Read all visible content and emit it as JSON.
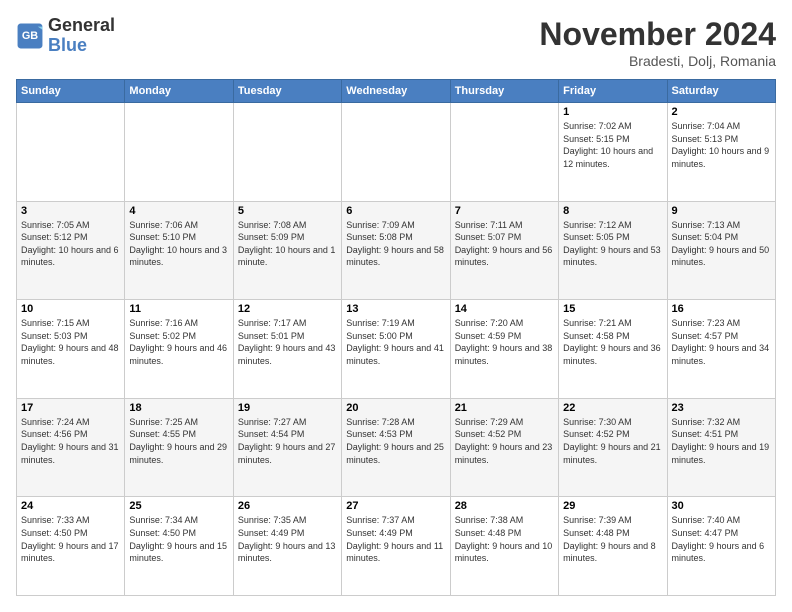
{
  "header": {
    "logo_line1": "General",
    "logo_line2": "Blue",
    "month": "November 2024",
    "location": "Bradesti, Dolj, Romania"
  },
  "weekdays": [
    "Sunday",
    "Monday",
    "Tuesday",
    "Wednesday",
    "Thursday",
    "Friday",
    "Saturday"
  ],
  "weeks": [
    [
      {
        "day": "",
        "info": ""
      },
      {
        "day": "",
        "info": ""
      },
      {
        "day": "",
        "info": ""
      },
      {
        "day": "",
        "info": ""
      },
      {
        "day": "",
        "info": ""
      },
      {
        "day": "1",
        "info": "Sunrise: 7:02 AM\nSunset: 5:15 PM\nDaylight: 10 hours and 12 minutes."
      },
      {
        "day": "2",
        "info": "Sunrise: 7:04 AM\nSunset: 5:13 PM\nDaylight: 10 hours and 9 minutes."
      }
    ],
    [
      {
        "day": "3",
        "info": "Sunrise: 7:05 AM\nSunset: 5:12 PM\nDaylight: 10 hours and 6 minutes."
      },
      {
        "day": "4",
        "info": "Sunrise: 7:06 AM\nSunset: 5:10 PM\nDaylight: 10 hours and 3 minutes."
      },
      {
        "day": "5",
        "info": "Sunrise: 7:08 AM\nSunset: 5:09 PM\nDaylight: 10 hours and 1 minute."
      },
      {
        "day": "6",
        "info": "Sunrise: 7:09 AM\nSunset: 5:08 PM\nDaylight: 9 hours and 58 minutes."
      },
      {
        "day": "7",
        "info": "Sunrise: 7:11 AM\nSunset: 5:07 PM\nDaylight: 9 hours and 56 minutes."
      },
      {
        "day": "8",
        "info": "Sunrise: 7:12 AM\nSunset: 5:05 PM\nDaylight: 9 hours and 53 minutes."
      },
      {
        "day": "9",
        "info": "Sunrise: 7:13 AM\nSunset: 5:04 PM\nDaylight: 9 hours and 50 minutes."
      }
    ],
    [
      {
        "day": "10",
        "info": "Sunrise: 7:15 AM\nSunset: 5:03 PM\nDaylight: 9 hours and 48 minutes."
      },
      {
        "day": "11",
        "info": "Sunrise: 7:16 AM\nSunset: 5:02 PM\nDaylight: 9 hours and 46 minutes."
      },
      {
        "day": "12",
        "info": "Sunrise: 7:17 AM\nSunset: 5:01 PM\nDaylight: 9 hours and 43 minutes."
      },
      {
        "day": "13",
        "info": "Sunrise: 7:19 AM\nSunset: 5:00 PM\nDaylight: 9 hours and 41 minutes."
      },
      {
        "day": "14",
        "info": "Sunrise: 7:20 AM\nSunset: 4:59 PM\nDaylight: 9 hours and 38 minutes."
      },
      {
        "day": "15",
        "info": "Sunrise: 7:21 AM\nSunset: 4:58 PM\nDaylight: 9 hours and 36 minutes."
      },
      {
        "day": "16",
        "info": "Sunrise: 7:23 AM\nSunset: 4:57 PM\nDaylight: 9 hours and 34 minutes."
      }
    ],
    [
      {
        "day": "17",
        "info": "Sunrise: 7:24 AM\nSunset: 4:56 PM\nDaylight: 9 hours and 31 minutes."
      },
      {
        "day": "18",
        "info": "Sunrise: 7:25 AM\nSunset: 4:55 PM\nDaylight: 9 hours and 29 minutes."
      },
      {
        "day": "19",
        "info": "Sunrise: 7:27 AM\nSunset: 4:54 PM\nDaylight: 9 hours and 27 minutes."
      },
      {
        "day": "20",
        "info": "Sunrise: 7:28 AM\nSunset: 4:53 PM\nDaylight: 9 hours and 25 minutes."
      },
      {
        "day": "21",
        "info": "Sunrise: 7:29 AM\nSunset: 4:52 PM\nDaylight: 9 hours and 23 minutes."
      },
      {
        "day": "22",
        "info": "Sunrise: 7:30 AM\nSunset: 4:52 PM\nDaylight: 9 hours and 21 minutes."
      },
      {
        "day": "23",
        "info": "Sunrise: 7:32 AM\nSunset: 4:51 PM\nDaylight: 9 hours and 19 minutes."
      }
    ],
    [
      {
        "day": "24",
        "info": "Sunrise: 7:33 AM\nSunset: 4:50 PM\nDaylight: 9 hours and 17 minutes."
      },
      {
        "day": "25",
        "info": "Sunrise: 7:34 AM\nSunset: 4:50 PM\nDaylight: 9 hours and 15 minutes."
      },
      {
        "day": "26",
        "info": "Sunrise: 7:35 AM\nSunset: 4:49 PM\nDaylight: 9 hours and 13 minutes."
      },
      {
        "day": "27",
        "info": "Sunrise: 7:37 AM\nSunset: 4:49 PM\nDaylight: 9 hours and 11 minutes."
      },
      {
        "day": "28",
        "info": "Sunrise: 7:38 AM\nSunset: 4:48 PM\nDaylight: 9 hours and 10 minutes."
      },
      {
        "day": "29",
        "info": "Sunrise: 7:39 AM\nSunset: 4:48 PM\nDaylight: 9 hours and 8 minutes."
      },
      {
        "day": "30",
        "info": "Sunrise: 7:40 AM\nSunset: 4:47 PM\nDaylight: 9 hours and 6 minutes."
      }
    ]
  ]
}
